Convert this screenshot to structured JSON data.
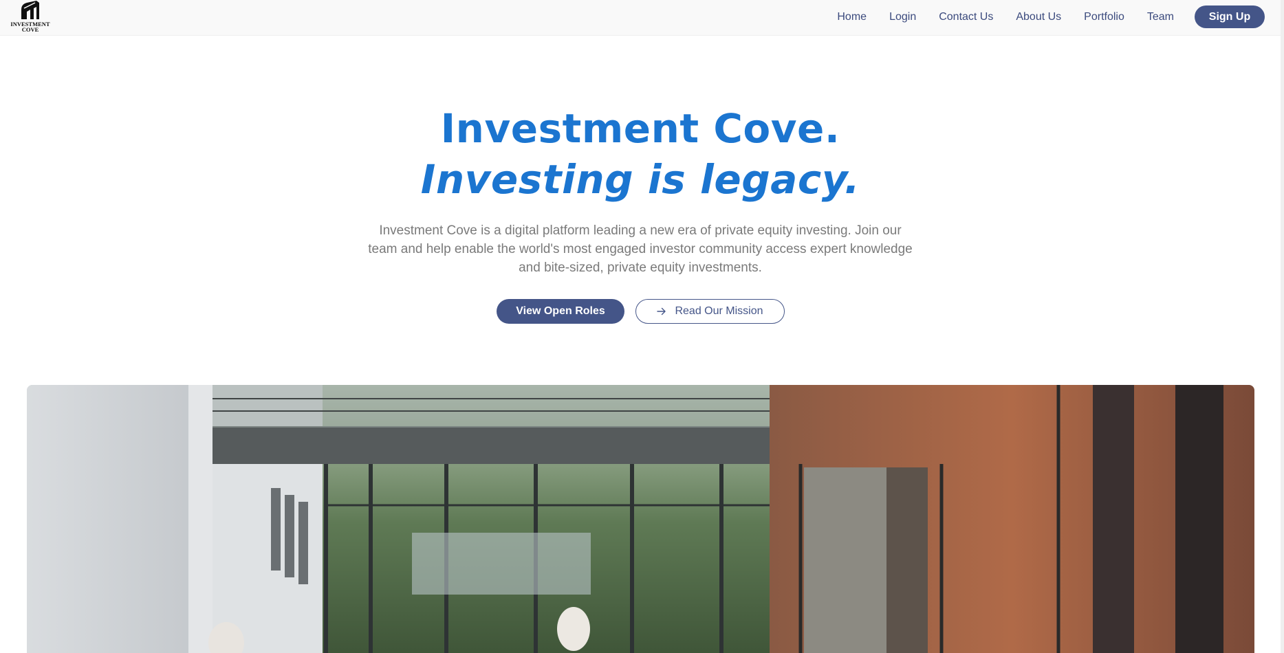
{
  "brand": {
    "logo_text_line1": "INVESTMENT",
    "logo_text_line2": "COVE"
  },
  "nav": {
    "links": [
      "Home",
      "Login",
      "Contact Us",
      "About Us",
      "Portfolio",
      "Team"
    ],
    "signup_label": "Sign Up"
  },
  "hero": {
    "title": "Investment Cove.",
    "subtitle": "Investing is legacy.",
    "description": "Investment Cove is a digital platform leading a new era of private equity investing. Join our team and help enable the world's most engaged investor community access expert knowledge and bite-sized, private equity investments.",
    "primary_cta": "View Open Roles",
    "secondary_cta": "Read Our Mission",
    "secondary_cta_icon": "arrow-right-icon"
  },
  "colors": {
    "accent_blue": "#1b75d0",
    "button_navy": "#445588",
    "body_text": "#7a7a7a"
  },
  "photo": {
    "icon": "building-photo"
  }
}
